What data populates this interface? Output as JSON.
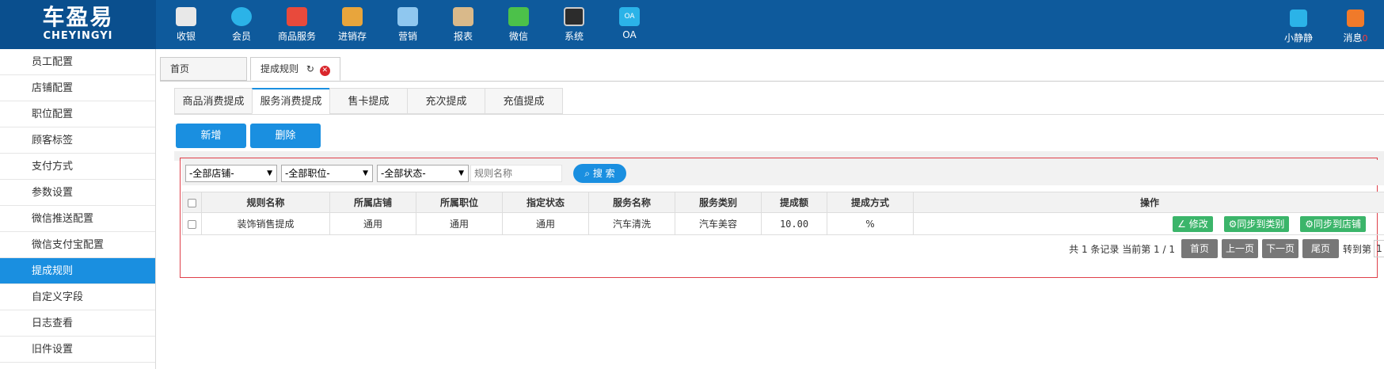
{
  "logo": {
    "cn": "车盈易",
    "en": "CHEYINGYI"
  },
  "nav": [
    {
      "label": "收银",
      "icon": "cash-register-icon",
      "color": "#e8e8e8"
    },
    {
      "label": "会员",
      "icon": "member-icon",
      "color": "#2bb3e8"
    },
    {
      "label": "商品服务",
      "icon": "goods-icon",
      "color": "#e84a3c"
    },
    {
      "label": "进销存",
      "icon": "inventory-icon",
      "color": "#e8a53c"
    },
    {
      "label": "营销",
      "icon": "megaphone-icon",
      "color": "#8fc7ef"
    },
    {
      "label": "报表",
      "icon": "report-icon",
      "color": "#d9b98a"
    },
    {
      "label": "微信",
      "icon": "wechat-icon",
      "color": "#4cc14a"
    },
    {
      "label": "系统",
      "icon": "monitor-icon",
      "color": "#2c2c2c"
    },
    {
      "label": "OA",
      "icon": "oa-icon",
      "color": "#2bb3e8"
    }
  ],
  "right_nav": [
    {
      "label": "小静静",
      "icon": "user-icon",
      "color": "#2bb3e8"
    },
    {
      "label": "消息",
      "badge": "0",
      "icon": "bell-icon",
      "color": "#f07a2a"
    }
  ],
  "sidebar": {
    "items": [
      "员工配置",
      "店铺配置",
      "职位配置",
      "顾客标签",
      "支付方式",
      "参数设置",
      "微信推送配置",
      "微信支付宝配置",
      "提成规则",
      "自定义字段",
      "日志查看",
      "旧件设置"
    ],
    "active": "提成规则"
  },
  "page_tabs": {
    "home": "首页",
    "current": "提成规则"
  },
  "sub_tabs": [
    "商品消费提成",
    "服务消费提成",
    "售卡提成",
    "充次提成",
    "充值提成"
  ],
  "toolbar": {
    "add": "新增",
    "delete": "删除"
  },
  "filters": {
    "store": "-全部店铺-",
    "position": "-全部职位-",
    "status": "-全部状态-",
    "name_placeholder": "规则名称",
    "search": "搜 索"
  },
  "table": {
    "headers": [
      "规则名称",
      "所属店铺",
      "所属职位",
      "指定状态",
      "服务名称",
      "服务类别",
      "提成额",
      "提成方式",
      "操作"
    ],
    "rows": [
      [
        "装饰销售提成",
        "通用",
        "通用",
        "通用",
        "汽车清洗",
        "汽车美容",
        "10.00",
        "%"
      ]
    ],
    "actions": [
      "修改",
      "同步到类别",
      "同步到店铺"
    ]
  },
  "pager": {
    "info": "共 1 条记录 当前第 1 / 1",
    "first": "首页",
    "prev": "上一页",
    "next": "下一页",
    "last": "尾页",
    "jump": "转到第",
    "page": "1"
  }
}
